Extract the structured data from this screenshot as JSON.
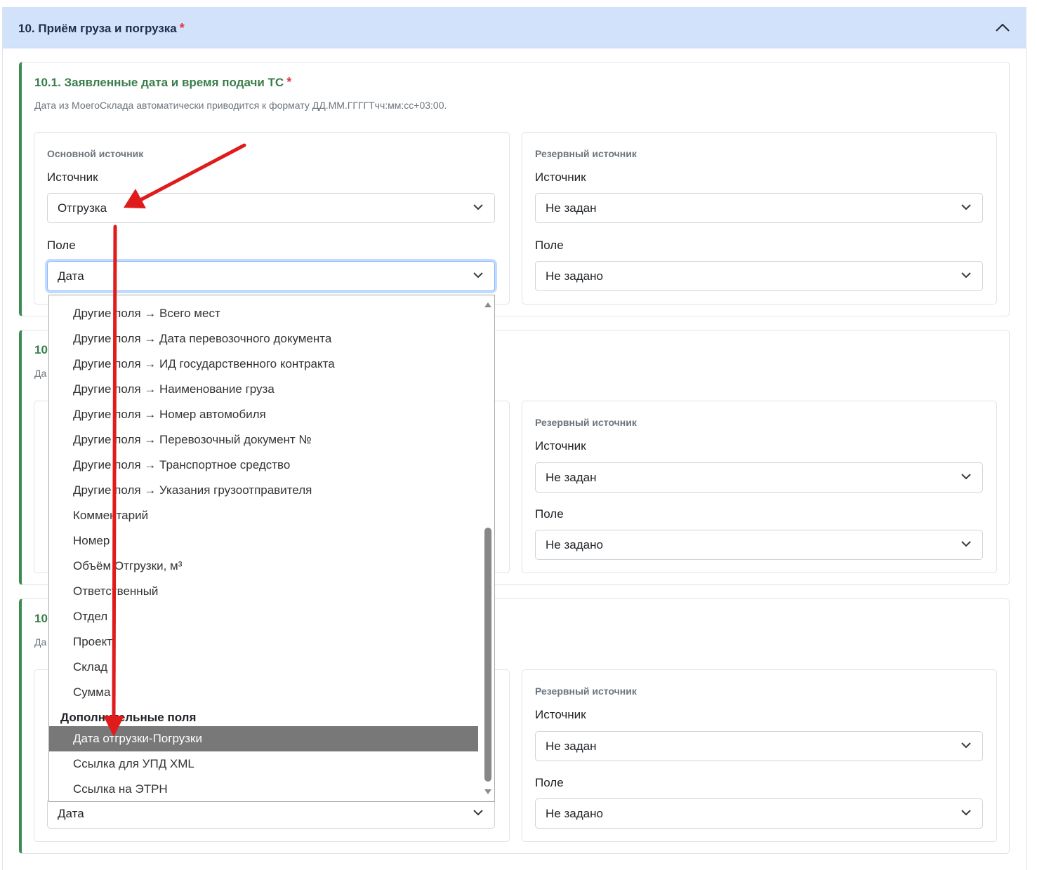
{
  "section": {
    "title": "10. Приём груза и погрузка",
    "required_mark": "*"
  },
  "card1": {
    "title": "10.1. Заявленные дата и время подачи ТС",
    "required_mark": "*",
    "description": "Дата из МоегоСклада автоматически приводится к формату ДД.ММ.ГГГГТчч:мм:сс+03:00.",
    "primary": {
      "heading": "Основной источник",
      "source_label": "Источник",
      "source_value": "Отгрузка",
      "field_label": "Поле",
      "field_value": "Дата"
    },
    "backup": {
      "heading": "Резервный источник",
      "source_label": "Источник",
      "source_value": "Не задан",
      "field_label": "Поле",
      "field_value": "Не задано"
    }
  },
  "card2": {
    "title_partial": "10.",
    "desc_partial": "Да",
    "backup": {
      "heading": "Резервный источник",
      "source_label": "Источник",
      "source_value": "Не задан",
      "field_label": "Поле",
      "field_value": "Не задано"
    }
  },
  "card3": {
    "title_partial": "10.",
    "desc_partial": "Да",
    "primary": {
      "field_value": "Дата"
    },
    "backup": {
      "heading": "Резервный источник",
      "source_label": "Источник",
      "source_value": "Не задан",
      "field_label": "Поле",
      "field_value": "Не задано"
    }
  },
  "dropdown": {
    "items": [
      "Другие поля → Всего мест",
      "Другие поля → Дата перевозочного документа",
      "Другие поля → ИД государственного контракта",
      "Другие поля → Наименование груза",
      "Другие поля → Номер автомобиля",
      "Другие поля → Перевозочный документ №",
      "Другие поля → Транспортное средство",
      "Другие поля → Указания грузоотправителя",
      "Комментарий",
      "Номер",
      "Объём Отгрузки, м³",
      "Ответственный",
      "Отдел",
      "Проект",
      "Склад",
      "Сумма"
    ],
    "group_label": "Дополнительные поля",
    "group_items": [
      "Дата отгрузки-Погрузки",
      "Ссылка для УПД XML",
      "Ссылка на ЭТРН"
    ],
    "highlighted": "Дата отгрузки-Погрузки"
  },
  "colors": {
    "accent_green": "#3d8b50",
    "header_bg": "#d3e2fb",
    "required": "#dc3545",
    "annotation_arrow": "#e01b1b",
    "highlight": "#787878"
  },
  "icons": {
    "collapse": "chevron-up-icon",
    "select": "chevron-down-icon",
    "annotation": "red-arrow-annotation"
  }
}
